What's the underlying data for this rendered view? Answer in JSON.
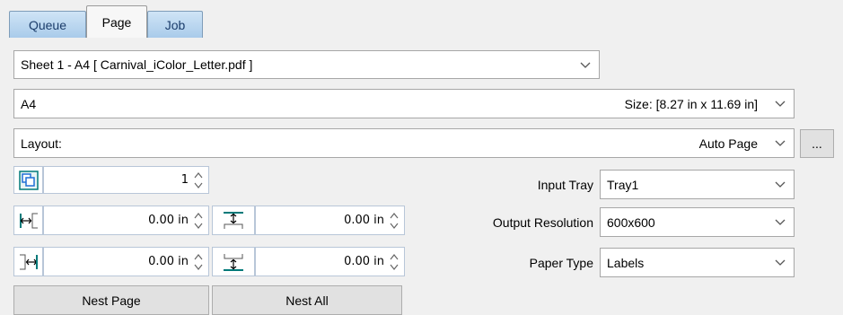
{
  "tabs": [
    {
      "label": "Queue"
    },
    {
      "label": "Page"
    },
    {
      "label": "Job"
    }
  ],
  "sheet_select": {
    "value": "Sheet 1 - A4 [ Carnival_iColor_Letter.pdf ]"
  },
  "size_select": {
    "value": "A4",
    "size_text": "Size: [8.27 in x 11.69 in]"
  },
  "layout_select": {
    "label": "Layout:",
    "value": "Auto Page",
    "more_label": "..."
  },
  "copies": {
    "value": "1"
  },
  "offsets": {
    "left": "0.00 in",
    "top": "0.00 in",
    "right": "0.00 in",
    "bottom": "0.00 in"
  },
  "input_tray": {
    "label": "Input Tray",
    "value": "Tray1"
  },
  "output_resolution": {
    "label": "Output Resolution",
    "value": "600x600"
  },
  "paper_type": {
    "label": "Paper Type",
    "value": "Labels"
  },
  "buttons": {
    "nest_page": "Nest Page",
    "nest_all": "Nest All"
  },
  "colors": {
    "tab_text": "#1b3d6b",
    "icon_teal": "#007a7a",
    "icon_blue": "#1f6fd6"
  }
}
